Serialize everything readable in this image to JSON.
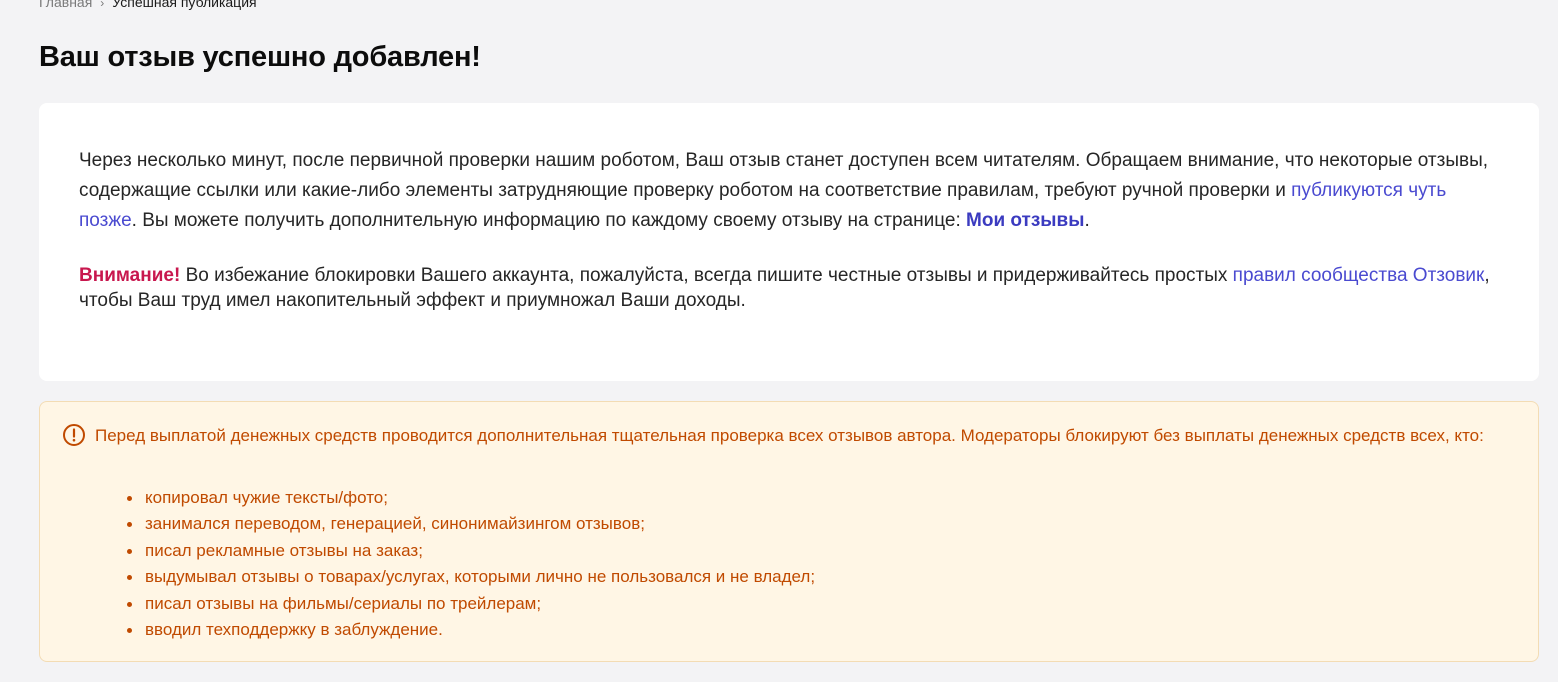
{
  "breadcrumb": {
    "home": "Главная",
    "separator": "›",
    "current": "Успешная публикация"
  },
  "page_title": "Ваш отзыв успешно добавлен!",
  "card": {
    "p1_text_a": "Через несколько минут, после первичной проверки нашим роботом, Ваш отзыв станет доступен всем читателям. Обращаем внимание, что некоторые отзывы, содержащие ссылки или какие-либо элементы затрудняющие проверку роботом на соответствие правилам, требуют ручной проверки и ",
    "p1_link": "публикуются чуть позже",
    "p1_text_b": ". Вы можете получить дополнительную информацию по каждому своему отзыву на странице: ",
    "my_reviews_link": "Мои отзывы",
    "p1_text_c": ".",
    "attention_label": "Внимание!",
    "p2_text_a": " Во избежание блокировки Вашего аккаунта, пожалуйста, всегда пишите честные отзывы и придерживайтесь простых ",
    "rules_link": "правил сообщества Отзовик",
    "p2_text_b": ", чтобы Ваш труд имел накопительный эффект и приумножал Ваши доходы."
  },
  "warning": {
    "icon": "exclamation-circle-icon",
    "intro": "Перед выплатой денежных средств проводится дополнительная тщательная проверка всех отзывов автора. Модераторы блокируют без выплаты денежных средств всех, кто:",
    "items": [
      "копировал чужие тексты/фото;",
      "занимался переводом, генерацией, синонимайзингом отзывов;",
      "писал рекламные отзывы на заказ;",
      "выдумывал отзывы о товарах/услугах, которыми лично не пользовался и не владел;",
      "писал отзывы на фильмы/сериалы по трейлерам;",
      "вводил техподдержку в заблуждение."
    ]
  },
  "colors": {
    "page_background": "#f3f3f5",
    "card_background": "#ffffff",
    "link": "#4a4ad0",
    "attention": "#c8174e",
    "warning_background": "#fff6e5",
    "warning_text": "#c04a00"
  }
}
